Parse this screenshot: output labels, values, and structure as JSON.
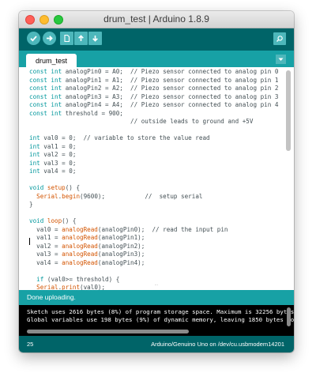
{
  "window": {
    "title": "drum_test | Arduino 1.8.9",
    "colors": {
      "toolbar": "#006468",
      "tabbar": "#17a1a5",
      "button": "#4db7bb",
      "keyword": "#00979c",
      "function": "#d35400",
      "code_text": "#434f54",
      "console_bg": "#000000"
    }
  },
  "toolbar": {
    "buttons": [
      {
        "name": "verify",
        "icon": "checkmark-icon"
      },
      {
        "name": "upload",
        "icon": "arrow-right-icon"
      },
      {
        "name": "new",
        "icon": "new-file-icon"
      },
      {
        "name": "open",
        "icon": "arrow-up-icon"
      },
      {
        "name": "save",
        "icon": "arrow-down-icon"
      }
    ],
    "serial_monitor_icon": "magnifier-icon"
  },
  "tabs": [
    {
      "label": "drum_test",
      "active": true
    }
  ],
  "editor": {
    "lines": [
      [
        {
          "t": "const int",
          "c": "kw"
        },
        {
          "t": " analogPin0 = A0;  // Piezo sensor connected to analog pin 0"
        }
      ],
      [
        {
          "t": "const int",
          "c": "kw"
        },
        {
          "t": " analogPin1 = A1;  // Piezo sensor connected to analog pin 1"
        }
      ],
      [
        {
          "t": "const int",
          "c": "kw"
        },
        {
          "t": " analogPin2 = A2;  // Piezo sensor connected to analog pin 2"
        }
      ],
      [
        {
          "t": "const int",
          "c": "kw"
        },
        {
          "t": " analogPin3 = A3;  // Piezo sensor connected to analog pin 3"
        }
      ],
      [
        {
          "t": "const int",
          "c": "kw"
        },
        {
          "t": " analogPin4 = A4;  // Piezo sensor connected to analog pin 4"
        }
      ],
      [
        {
          "t": "const int",
          "c": "kw"
        },
        {
          "t": " threshold = 900;"
        }
      ],
      [
        {
          "t": "                            // outside leads to ground and +5V"
        }
      ],
      [
        {
          "t": ""
        }
      ],
      [
        {
          "t": "int",
          "c": "kw"
        },
        {
          "t": " val0 = 0;  // variable to store the value read"
        }
      ],
      [
        {
          "t": "int",
          "c": "kw"
        },
        {
          "t": " val1 = 0;"
        }
      ],
      [
        {
          "t": "int",
          "c": "kw"
        },
        {
          "t": " val2 = 0;"
        }
      ],
      [
        {
          "t": "int",
          "c": "kw"
        },
        {
          "t": " val3 = 0;"
        }
      ],
      [
        {
          "t": "int",
          "c": "kw"
        },
        {
          "t": " val4 = 0;"
        }
      ],
      [
        {
          "t": ""
        }
      ],
      [
        {
          "t": "void",
          "c": "kw"
        },
        {
          "t": " "
        },
        {
          "t": "setup",
          "c": "fn"
        },
        {
          "t": "() {"
        }
      ],
      [
        {
          "t": "  "
        },
        {
          "t": "Serial",
          "c": "fn"
        },
        {
          "t": "."
        },
        {
          "t": "begin",
          "c": "fn"
        },
        {
          "t": "(9600);           //  setup serial"
        }
      ],
      [
        {
          "t": "}"
        }
      ],
      [
        {
          "t": ""
        }
      ],
      [
        {
          "t": "void",
          "c": "kw"
        },
        {
          "t": " "
        },
        {
          "t": "loop",
          "c": "fn"
        },
        {
          "t": "() {"
        }
      ],
      [
        {
          "t": "  val0 = "
        },
        {
          "t": "analogRead",
          "c": "fn"
        },
        {
          "t": "(analogPin0);  // read the input pin"
        }
      ],
      [
        {
          "t": "  val1 = "
        },
        {
          "t": "analogRead",
          "c": "fn"
        },
        {
          "t": "(analogPin1);"
        }
      ],
      [
        {
          "t": "  val2 = "
        },
        {
          "t": "analogRead",
          "c": "fn"
        },
        {
          "t": "(analogPin2);"
        }
      ],
      [
        {
          "t": "  val3 = "
        },
        {
          "t": "analogRead",
          "c": "fn"
        },
        {
          "t": "(analogPin3);"
        }
      ],
      [
        {
          "t": "  val4 = "
        },
        {
          "t": "analogRead",
          "c": "fn"
        },
        {
          "t": "(analogPin4);"
        }
      ],
      [
        {
          "t": ""
        }
      ],
      [
        {
          "t": "  "
        },
        {
          "t": "if",
          "c": "kw"
        },
        {
          "t": " (val0>= threshold) {"
        }
      ],
      [
        {
          "t": "  "
        },
        {
          "t": "Serial",
          "c": "fn"
        },
        {
          "t": "."
        },
        {
          "t": "print",
          "c": "fn"
        },
        {
          "t": "(val0);"
        }
      ],
      [
        {
          "t": "  "
        },
        {
          "t": "Serial",
          "c": "fn"
        },
        {
          "t": "."
        },
        {
          "t": "print",
          "c": "fn"
        },
        {
          "t": "(\" \");"
        }
      ]
    ]
  },
  "status": {
    "message": "Done uploading."
  },
  "console": {
    "lines": [
      "Sketch uses 2616 bytes (8%) of program storage space. Maximum is 32256 bytes.",
      "Global variables use 198 bytes (9%) of dynamic memory, leaving 1850 bytes for local variables."
    ]
  },
  "footer": {
    "line_number": "25",
    "board": "Arduino/Genuino Uno on /dev/cu.usbmodem14201"
  }
}
